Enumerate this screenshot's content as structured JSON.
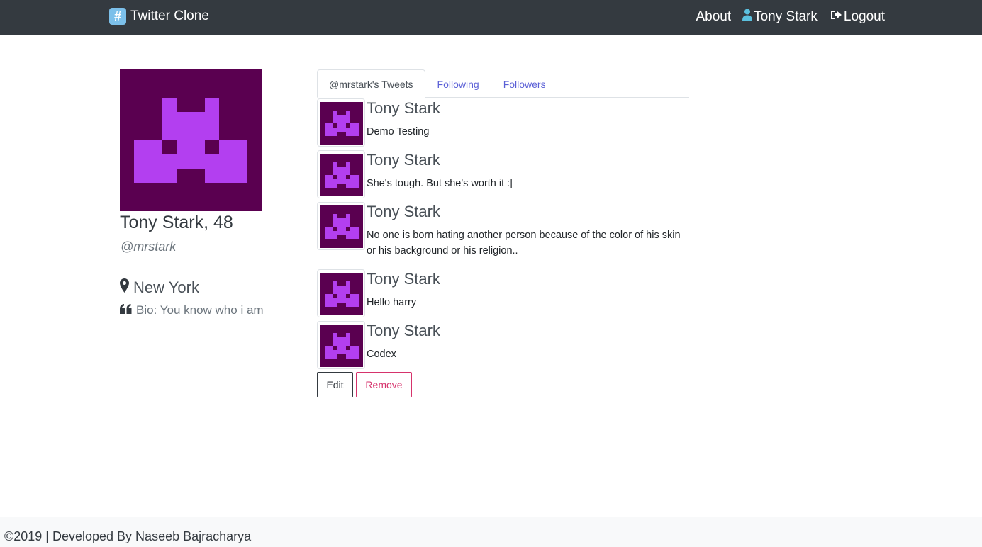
{
  "navbar": {
    "brand_icon": "hash-icon",
    "brand_label": "Twitter Clone",
    "about_label": "About",
    "user_label": "Tony Stark",
    "logout_label": "Logout",
    "bg_color": "#343a40"
  },
  "profile": {
    "name_age": "Tony Stark, 48",
    "handle": "@mrstark",
    "location": "New York",
    "bio": "Bio: You know who i am",
    "avatar_bg": "#5a0050",
    "avatar_fg": "#b33ff0"
  },
  "tabs": [
    {
      "label": "@mrstark's Tweets",
      "active": true
    },
    {
      "label": "Following",
      "active": false
    },
    {
      "label": "Followers",
      "active": false
    }
  ],
  "tweets": [
    {
      "author": "Tony Stark",
      "text": "Demo Testing"
    },
    {
      "author": "Tony Stark",
      "text": "She's tough. But she's worth it :|"
    },
    {
      "author": "Tony Stark",
      "text": "No one is born hating another person because of the color of his skin or his background or his religion.."
    },
    {
      "author": "Tony Stark",
      "text": "Hello harry"
    },
    {
      "author": "Tony Stark",
      "text": "Codex"
    }
  ],
  "actions": {
    "edit_label": "Edit",
    "remove_label": "Remove"
  },
  "footer": {
    "text": "©2019 | Developed By Naseeb Bajracharya"
  }
}
